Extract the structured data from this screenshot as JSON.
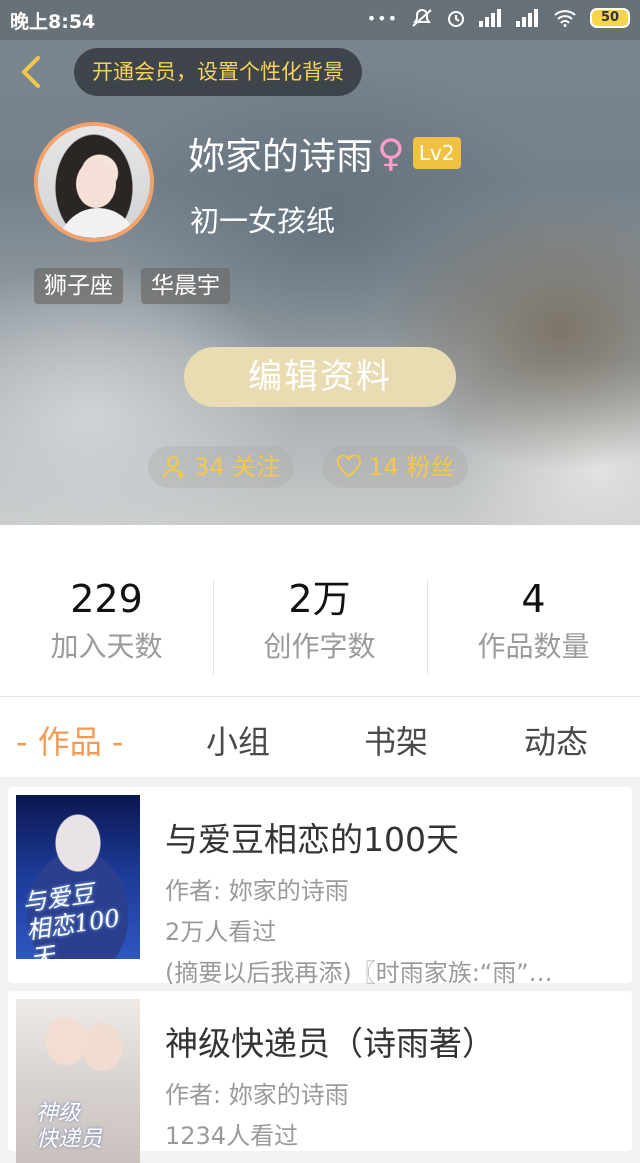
{
  "status_bar": {
    "time": "晚上8:54",
    "battery": "50"
  },
  "header": {
    "vip_prompt": "开通会员，设置个性化背景",
    "nickname": "妳家的诗雨",
    "gender_symbol": "♀",
    "level": "Lv2",
    "signature": "初一女孩纸",
    "tags": [
      "狮子座",
      "华晨宇"
    ],
    "edit_button": "编辑资料",
    "following_label": "34 关注",
    "followers_label": "14 粉丝",
    "accent_color": "#f4c84a"
  },
  "stats": [
    {
      "value": "229",
      "label": "加入天数"
    },
    {
      "value": "2万",
      "label": "创作字数"
    },
    {
      "value": "4",
      "label": "作品数量"
    }
  ],
  "tabs": [
    {
      "label": "- 作品 -",
      "active": true
    },
    {
      "label": "小组",
      "active": false
    },
    {
      "label": "书架",
      "active": false
    },
    {
      "label": "动态",
      "active": false
    }
  ],
  "works": [
    {
      "title": "与爱豆相恋的100天",
      "author": "作者: 妳家的诗雨",
      "views": "2万人看过",
      "summary": "(摘要以后我再添)〖时雨家族:“雨”…",
      "cover_text": "与爱豆\n相恋100天"
    },
    {
      "title": "神级快递员（诗雨著）",
      "author": "作者: 妳家的诗雨",
      "views": "1234人看过",
      "cover_text": "神级\n快递员"
    }
  ]
}
